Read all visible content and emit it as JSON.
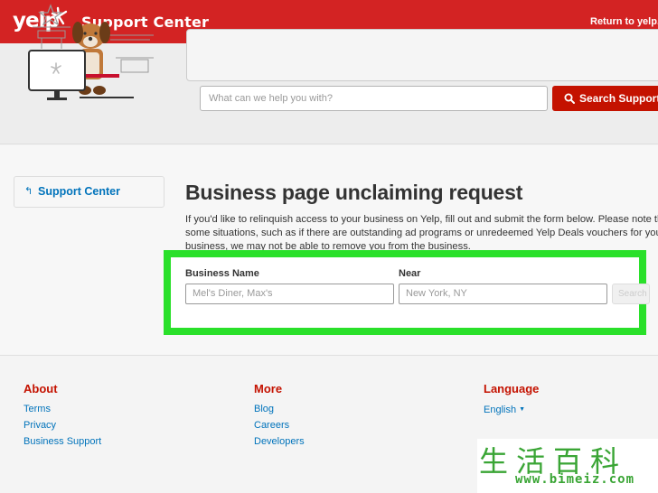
{
  "header": {
    "logo_text": "yelp",
    "title": "Support Center",
    "return_link": "Return to yelp.c"
  },
  "search": {
    "placeholder": "What can we help you with?",
    "button_label": "Search Support"
  },
  "sidebar": {
    "back_arrow": "↰",
    "link_label": "Support Center"
  },
  "main": {
    "title": "Business page unclaiming request",
    "intro_lines": [
      "If you'd like to relinquish access to your business on Yelp, fill out and submit the form below. Please note tha",
      "some situations, such as if there are outstanding ad programs or unredeemed Yelp Deals vouchers for your",
      "business, we may not be able to remove you from the business."
    ]
  },
  "form": {
    "business_name_label": "Business Name",
    "business_name_placeholder": "Mel's Diner, Max's",
    "near_label": "Near",
    "near_placeholder": "New York, NY",
    "search_button": "Search"
  },
  "footer": {
    "about": {
      "heading": "About",
      "links": [
        "Terms",
        "Privacy",
        "Business Support"
      ]
    },
    "more": {
      "heading": "More",
      "links": [
        "Blog",
        "Careers",
        "Developers"
      ]
    },
    "language": {
      "heading": "Language",
      "selected": "English"
    }
  },
  "watermark": {
    "characters": "生活百科",
    "url": "www.bimeiz.com"
  },
  "colors": {
    "brand_red": "#d32323",
    "button_red": "#c41200",
    "link_blue": "#0073bb",
    "highlight_green": "#2ae02a"
  }
}
